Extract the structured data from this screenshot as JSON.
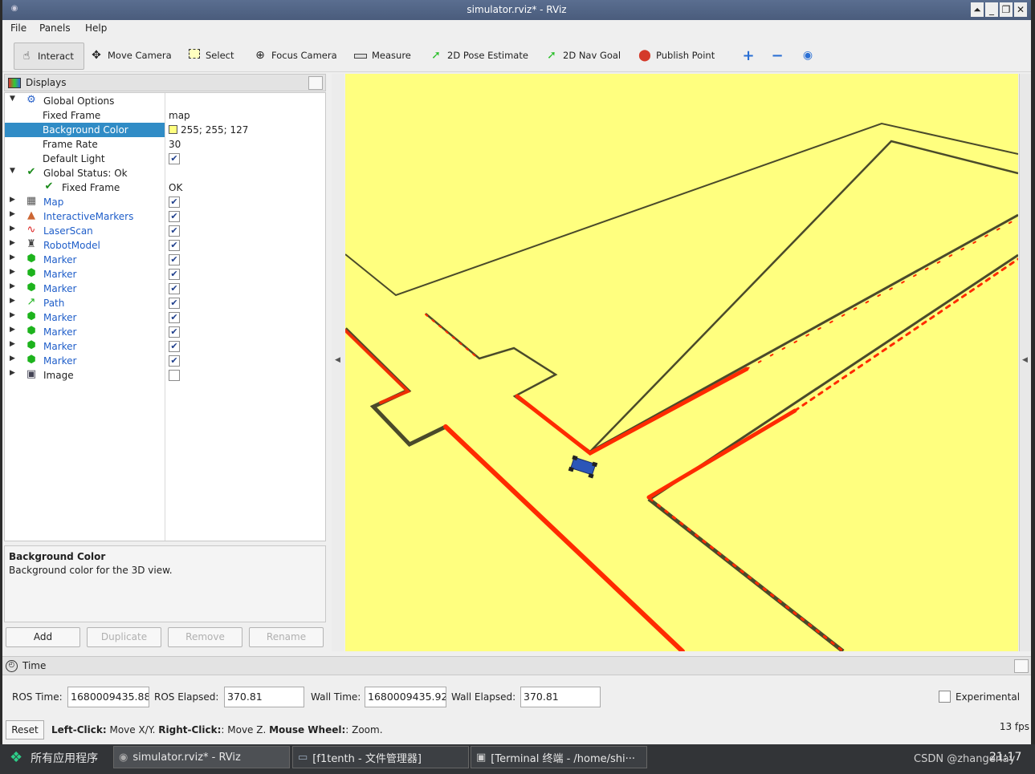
{
  "window": {
    "title": "simulator.rviz* - RViz"
  },
  "menu": [
    "File",
    "Panels",
    "Help"
  ],
  "toolbar": {
    "interact": "Interact",
    "move_camera": "Move Camera",
    "select": "Select",
    "focus_camera": "Focus Camera",
    "measure": "Measure",
    "pose_estimate": "2D Pose Estimate",
    "nav_goal": "2D Nav Goal",
    "publish_point": "Publish Point"
  },
  "displays": {
    "title": "Displays",
    "global_options": "Global Options",
    "fixed_frame_label": "Fixed Frame",
    "fixed_frame_value": "map",
    "bg_color_label": "Background Color",
    "bg_color_value": "255; 255; 127",
    "frame_rate_label": "Frame Rate",
    "frame_rate_value": "30",
    "default_light_label": "Default Light",
    "global_status": "Global Status: Ok",
    "status_fixed_frame": "Fixed Frame",
    "status_fixed_frame_value": "OK",
    "items": [
      {
        "label": "Map",
        "checked": true
      },
      {
        "label": "InteractiveMarkers",
        "checked": true
      },
      {
        "label": "LaserScan",
        "checked": true
      },
      {
        "label": "RobotModel",
        "checked": true
      },
      {
        "label": "Marker",
        "checked": true
      },
      {
        "label": "Marker",
        "checked": true
      },
      {
        "label": "Marker",
        "checked": true
      },
      {
        "label": "Path",
        "checked": true
      },
      {
        "label": "Marker",
        "checked": true
      },
      {
        "label": "Marker",
        "checked": true
      },
      {
        "label": "Marker",
        "checked": true
      },
      {
        "label": "Marker",
        "checked": true
      },
      {
        "label": "Image",
        "checked": false
      }
    ]
  },
  "description": {
    "title": "Background Color",
    "body": "Background color for the 3D view."
  },
  "buttons": {
    "add": "Add",
    "duplicate": "Duplicate",
    "remove": "Remove",
    "rename": "Rename"
  },
  "time": {
    "title": "Time",
    "ros_time_label": "ROS Time:",
    "ros_time_value": "1680009435.88",
    "ros_elapsed_label": "ROS Elapsed:",
    "ros_elapsed_value": "370.81",
    "wall_time_label": "Wall Time:",
    "wall_time_value": "1680009435.92",
    "wall_elapsed_label": "Wall Elapsed:",
    "wall_elapsed_value": "370.81",
    "experimental": "Experimental"
  },
  "status": {
    "reset": "Reset",
    "lc": "Left-Click:",
    "lc_desc": " Move X/Y. ",
    "rc": "Right-Click:",
    "rc_desc": ": Move Z. ",
    "mw": "Mouse Wheel:",
    "mw_desc": ": Zoom.",
    "fps": "13 fps"
  },
  "taskbar": {
    "start": "所有应用程序",
    "tasks": [
      "simulator.rviz* - RViz",
      "[f1tenth - 文件管理器]",
      "[Terminal 终端 - /home/shi···"
    ],
    "watermark": "CSDN @zhangerlay",
    "clock": "21:17"
  },
  "colors": {
    "background": "#ffff7f",
    "wall": "#4a4a2a",
    "scan": "#ff2a00",
    "selection": "#308cc6"
  }
}
